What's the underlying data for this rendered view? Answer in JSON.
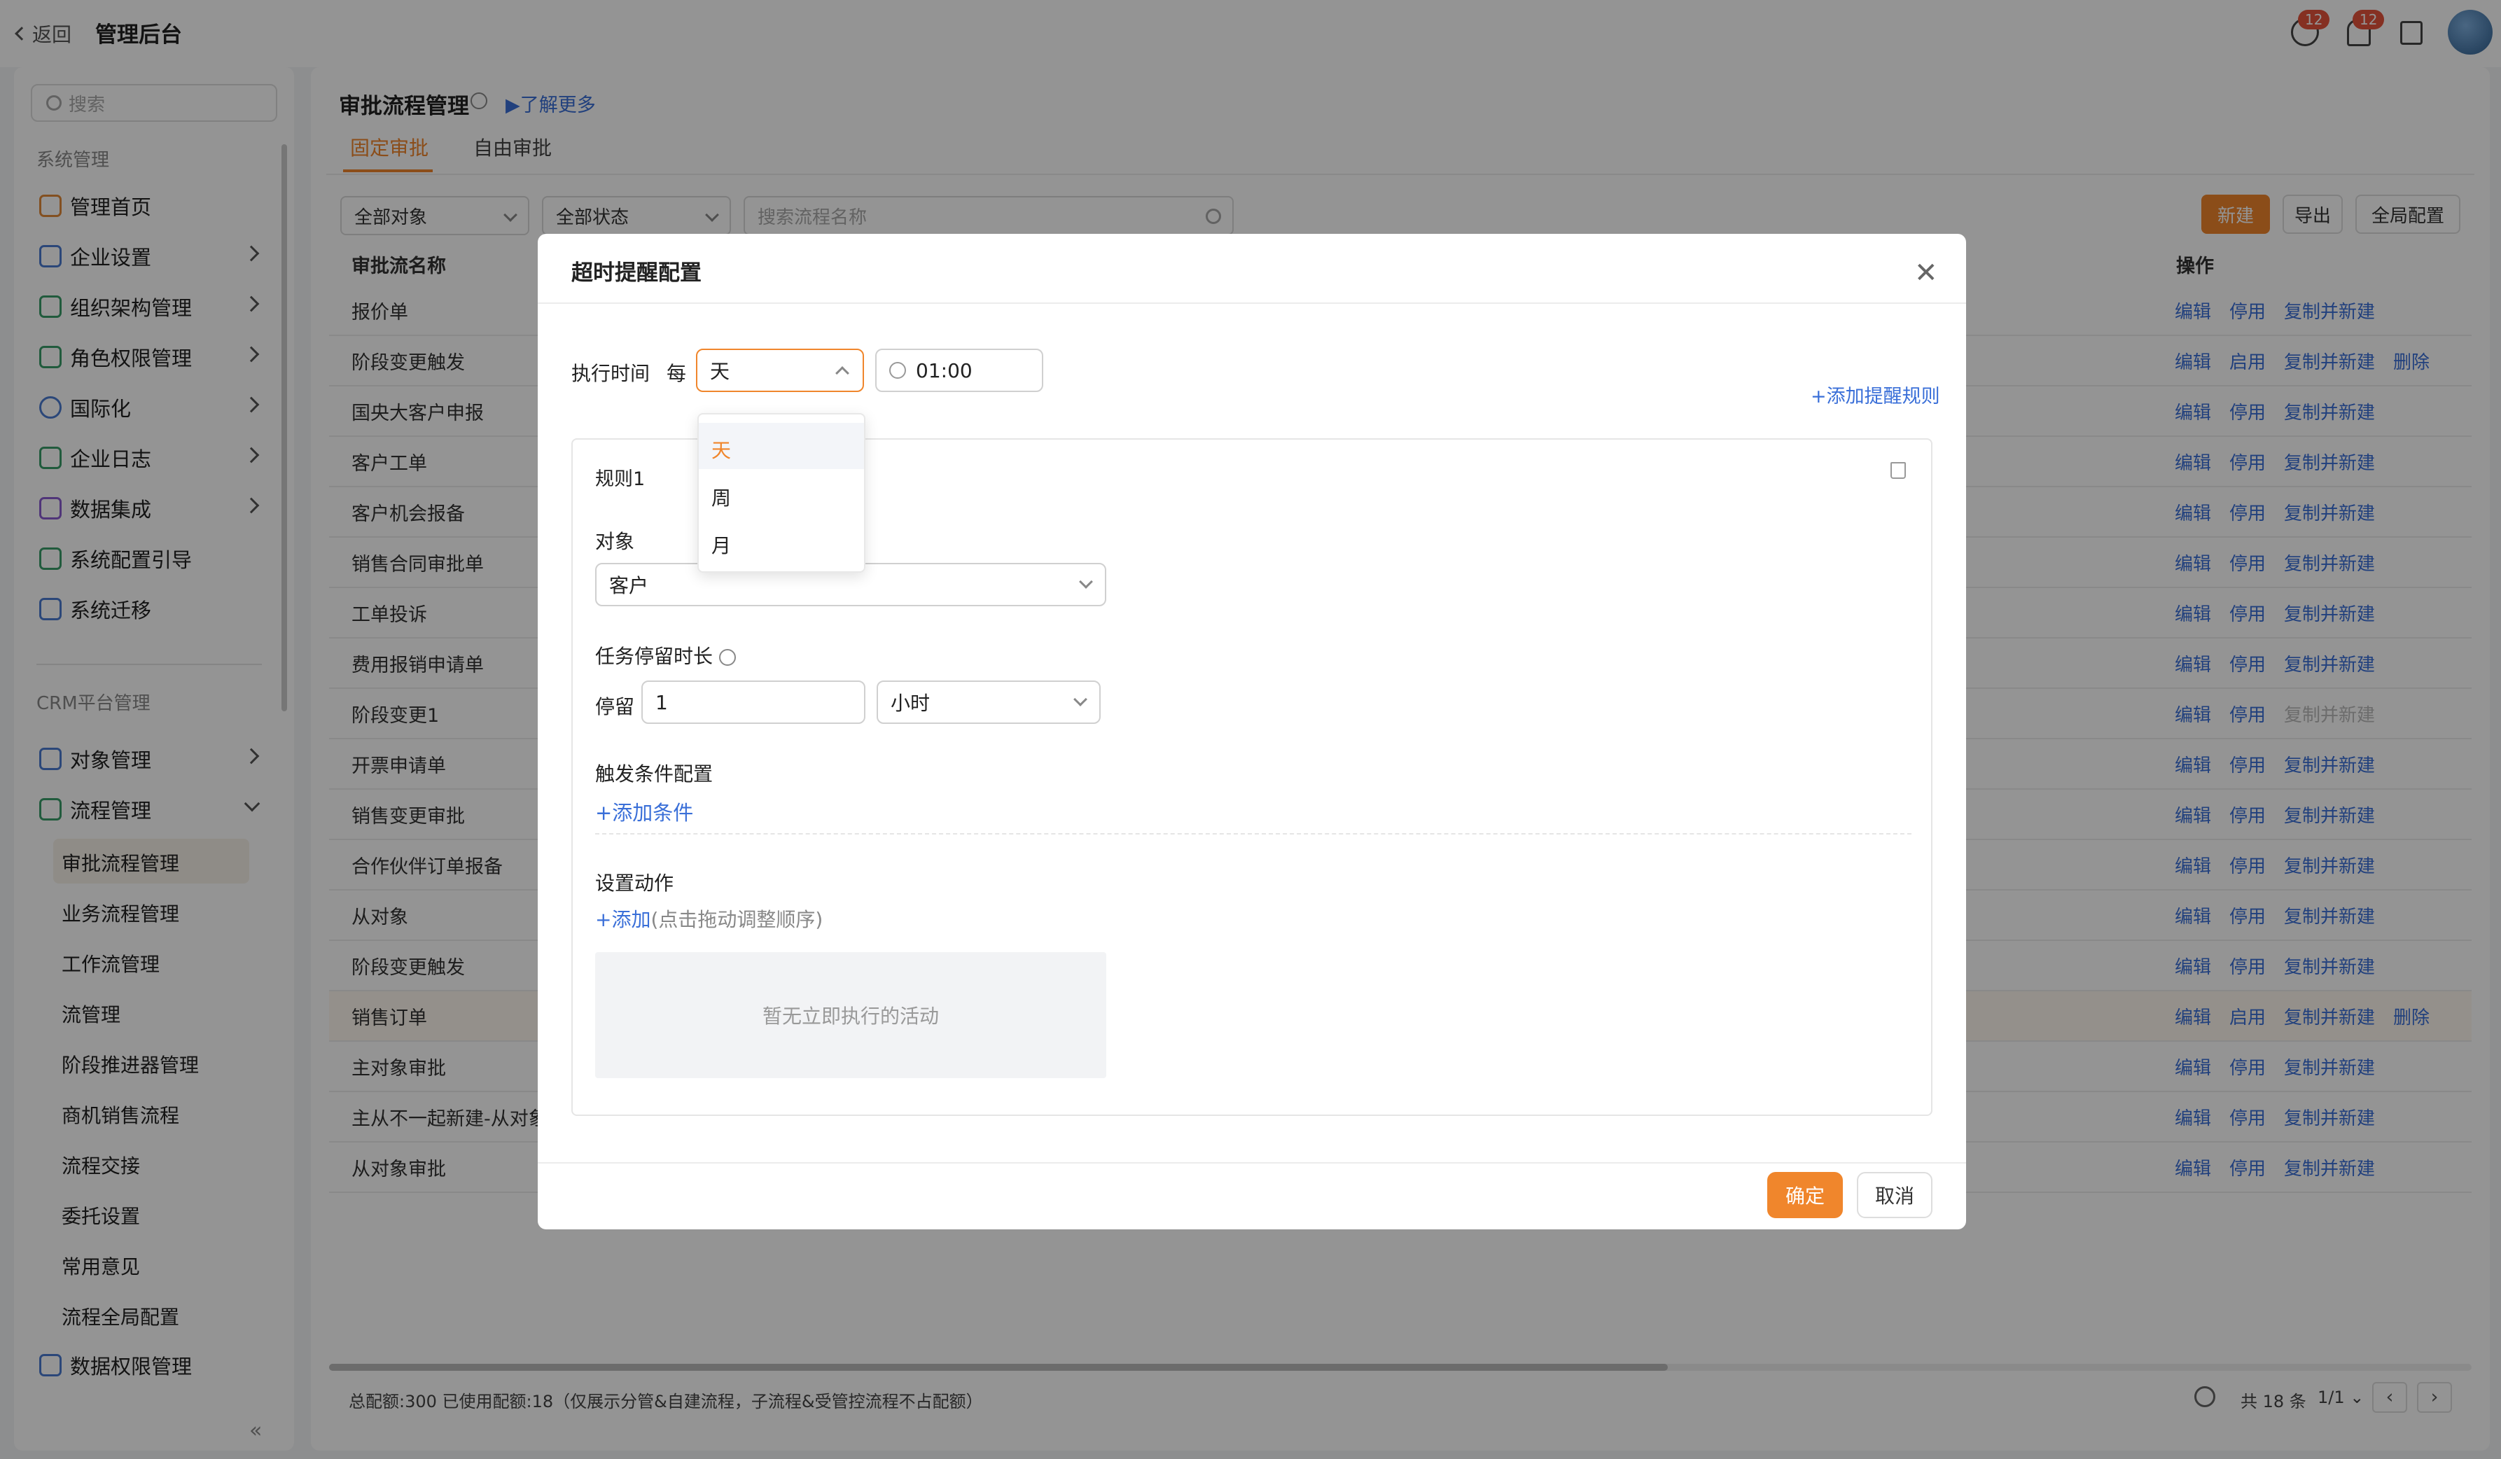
{
  "topbar": {
    "back_label": "返回",
    "title": "管理后台",
    "chat_badge": "12",
    "bell_badge": "12"
  },
  "sidebar": {
    "search_placeholder": "搜索",
    "section1": "系统管理",
    "items1": [
      {
        "label": "管理首页",
        "icon": "home-icon"
      },
      {
        "label": "企业设置",
        "icon": "building-icon"
      },
      {
        "label": "组织架构管理",
        "icon": "org-icon"
      },
      {
        "label": "角色权限管理",
        "icon": "role-icon"
      },
      {
        "label": "国际化",
        "icon": "globe-icon"
      },
      {
        "label": "企业日志",
        "icon": "log-icon"
      },
      {
        "label": "数据集成",
        "icon": "chip-icon"
      },
      {
        "label": "系统配置引导",
        "icon": "guide-icon"
      },
      {
        "label": "系统迁移",
        "icon": "migrate-icon"
      }
    ],
    "section2": "CRM平台管理",
    "items2": [
      {
        "label": "对象管理",
        "icon": "cube-icon"
      },
      {
        "label": "流程管理",
        "icon": "flow-icon"
      }
    ],
    "subitems": [
      "审批流程管理",
      "业务流程管理",
      "工作流管理",
      "流管理",
      "阶段推进器管理",
      "商机销售流程",
      "流程交接",
      "委托设置",
      "常用意见",
      "流程全局配置"
    ],
    "last_item": {
      "label": "数据权限管理",
      "icon": "data-perm-icon"
    }
  },
  "main": {
    "title": "审批流程管理",
    "learn_more": "了解更多",
    "tabs": [
      "固定审批",
      "自由审批"
    ],
    "filter_object": "全部对象",
    "filter_status": "全部状态",
    "search_placeholder": "搜索流程名称",
    "btn_new": "新建",
    "btn_export": "导出",
    "btn_global": "全局配置",
    "col_name": "审批流名称",
    "col_ops": "操作",
    "rows": [
      {
        "name": "报价单",
        "ops": [
          "编辑",
          "停用",
          "复制并新建"
        ]
      },
      {
        "name": "阶段变更触发",
        "ops": [
          "编辑",
          "启用",
          "复制并新建",
          "删除"
        ]
      },
      {
        "name": "国央大客户申报",
        "ops": [
          "编辑",
          "停用",
          "复制并新建"
        ]
      },
      {
        "name": "客户工单",
        "ops": [
          "编辑",
          "停用",
          "复制并新建"
        ]
      },
      {
        "name": "客户机会报备",
        "ops": [
          "编辑",
          "停用",
          "复制并新建"
        ]
      },
      {
        "name": "销售合同审批单",
        "ops": [
          "编辑",
          "停用",
          "复制并新建"
        ]
      },
      {
        "name": "工单投诉",
        "ops": [
          "编辑",
          "停用",
          "复制并新建"
        ]
      },
      {
        "name": "费用报销申请单",
        "ops": [
          "编辑",
          "停用",
          "复制并新建"
        ]
      },
      {
        "name": "阶段变更1",
        "ops": [
          "编辑",
          "停用",
          "复制并新建"
        ]
      },
      {
        "name": "开票申请单",
        "ops": [
          "编辑",
          "停用",
          "复制并新建"
        ]
      },
      {
        "name": "销售变更审批",
        "ops": [
          "编辑",
          "停用",
          "复制并新建"
        ]
      },
      {
        "name": "合作伙伴订单报备",
        "ops": [
          "编辑",
          "停用",
          "复制并新建"
        ]
      },
      {
        "name": "从对象",
        "ops": [
          "编辑",
          "停用",
          "复制并新建"
        ]
      },
      {
        "name": "阶段变更触发",
        "ops": [
          "编辑",
          "停用",
          "复制并新建"
        ]
      },
      {
        "name": "销售订单",
        "ops": [
          "编辑",
          "启用",
          "复制并新建",
          "删除"
        ]
      },
      {
        "name": "主对象审批",
        "ops": [
          "编辑",
          "停用",
          "复制并新建"
        ]
      },
      {
        "name": "主从不一起新建-从对象",
        "ops": [
          "编辑",
          "停用",
          "复制并新建"
        ]
      },
      {
        "name": "从对象审批",
        "ops": [
          "编辑",
          "停用",
          "复制并新建"
        ]
      }
    ],
    "footer_note": "总配额:300 已使用配额:18（仅展示分管&自建流程，子流程&受管控流程不占配额）",
    "total": "共 18 条",
    "page": "1/1"
  },
  "modal": {
    "title": "超时提醒配置",
    "exec_label": "执行时间",
    "every": "每",
    "freq_value": "天",
    "time_value": "01:00",
    "add_rule": "+添加提醒规则",
    "dropdown": [
      "天",
      "周",
      "月"
    ],
    "rule_title": "规则1",
    "object_label": "对象",
    "object_value": "客户",
    "stay_label": "任务停留时长",
    "stay_prefix": "停留",
    "stay_value": "1",
    "stay_unit": "小时",
    "trigger_label": "触发条件配置",
    "add_condition": "+添加条件",
    "action_label": "设置动作",
    "add_action": "+添加",
    "add_action_hint": "(点击拖动调整顺序)",
    "empty_text": "暂无立即执行的活动",
    "ok": "确定",
    "cancel": "取消"
  },
  "colors": {
    "accent": "#f0862c",
    "link": "#3a6fd8"
  }
}
